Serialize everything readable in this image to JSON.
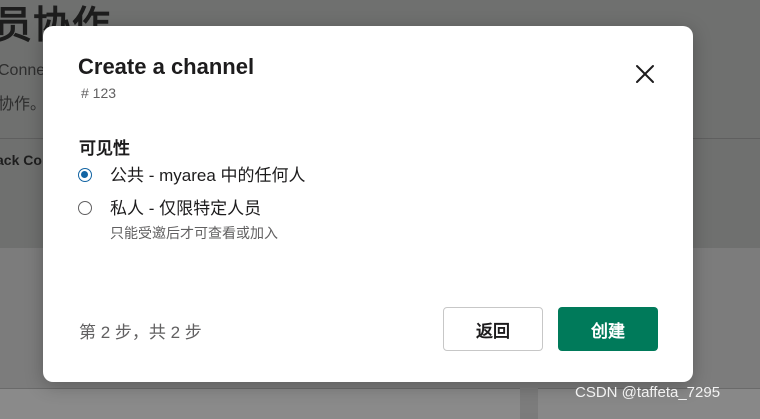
{
  "background": {
    "title": "员协作",
    "line1": "Conne",
    "line2": "协作。",
    "tab": "ack Co"
  },
  "modal": {
    "title": "Create a channel",
    "subtitle": "# 123",
    "close_icon": "close-icon",
    "section_label": "可见性",
    "options": [
      {
        "label": "公共 - myarea 中的任何人",
        "description": "",
        "checked": true
      },
      {
        "label": "私人 - 仅限特定人员",
        "description": "只能受邀后才可查看或加入",
        "checked": false
      }
    ],
    "step_text": "第 2 步，共 2 步",
    "back_label": "返回",
    "create_label": "创建"
  },
  "colors": {
    "primary_green": "#007a5a",
    "radio_blue": "#1264a3"
  },
  "watermark": "CSDN @taffeta_7295"
}
